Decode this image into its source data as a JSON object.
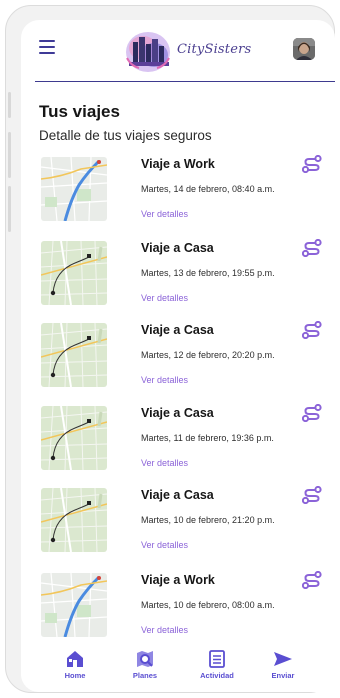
{
  "header": {
    "app_name": "CitySisters"
  },
  "page": {
    "title": "Tus viajes",
    "subtitle": "Detalle de tus viajes seguros"
  },
  "trips": [
    {
      "title": "Viaje a Work",
      "date": "Martes, 14 de febrero, 08:40 a.m.",
      "link": "Ver detalles",
      "map": "city"
    },
    {
      "title": "Viaje a Casa",
      "date": "Martes, 13 de febrero, 19:55 p.m.",
      "link": "Ver detalles",
      "map": "route"
    },
    {
      "title": "Viaje a Casa",
      "date": "Martes, 12 de febrero, 20:20 p.m.",
      "link": "Ver detalles",
      "map": "route"
    },
    {
      "title": "Viaje a Casa",
      "date": "Martes, 11 de febrero, 19:36 p.m.",
      "link": "Ver detalles",
      "map": "route"
    },
    {
      "title": "Viaje a Casa",
      "date": "Martes, 10 de febrero, 21:20 p.m.",
      "link": "Ver detalles",
      "map": "route"
    },
    {
      "title": "Viaje a Work",
      "date": "Martes, 10 de febrero, 08:00 a.m.",
      "link": "Ver detalles",
      "map": "city"
    }
  ],
  "nav": [
    {
      "label": "Home",
      "icon": "home-icon"
    },
    {
      "label": "Planes",
      "icon": "map-search-icon"
    },
    {
      "label": "Actividad",
      "icon": "list-icon"
    },
    {
      "label": "Enviar",
      "icon": "send-icon"
    }
  ],
  "colors": {
    "accent": "#5a4ed1",
    "link": "#8b63d8",
    "header_rule": "#3e3a8f"
  }
}
